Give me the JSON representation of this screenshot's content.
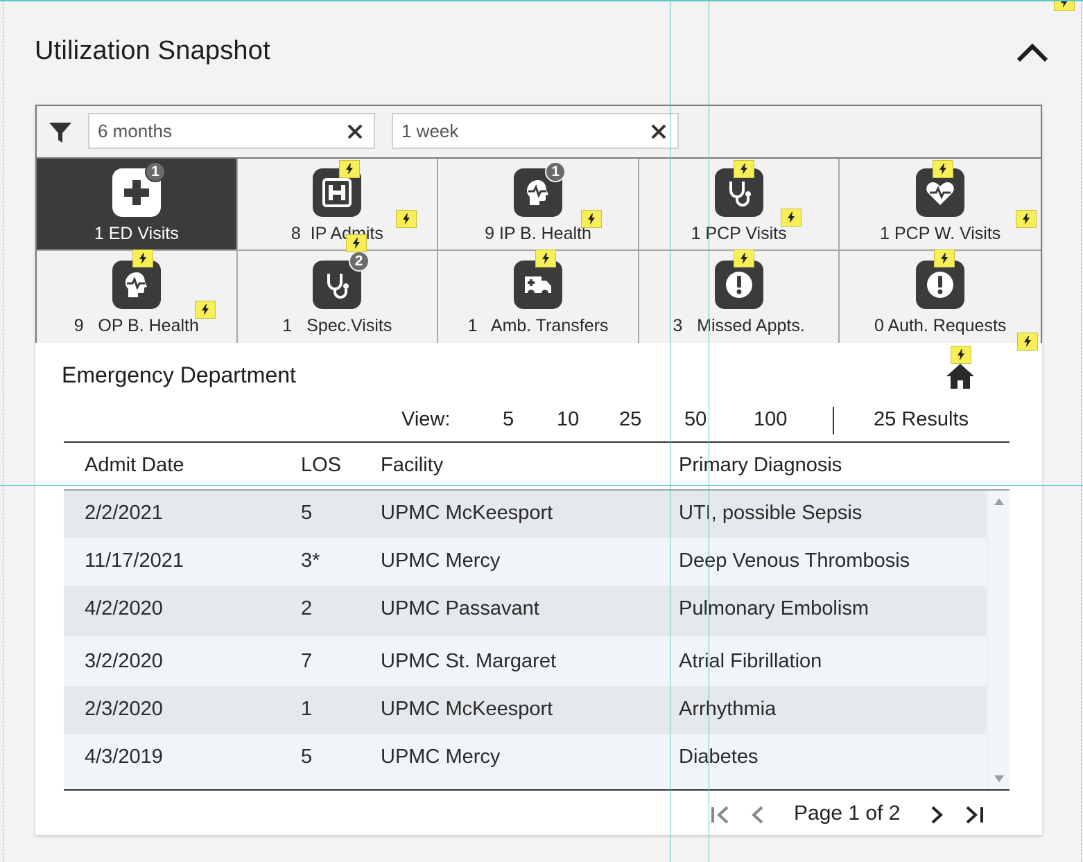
{
  "panel": {
    "title": "Utilization Snapshot"
  },
  "filters": [
    {
      "value": "6 months"
    },
    {
      "value": "1 week"
    }
  ],
  "tiles": [
    {
      "label": "1 ED Visits",
      "icon": "hospital-plus-icon",
      "badge": "1",
      "active": true
    },
    {
      "label": "8  IP Admits",
      "icon": "hospital-h-icon",
      "badge": null,
      "active": false
    },
    {
      "label": "9 IP B. Health",
      "icon": "behavioral-head-icon",
      "badge": "1",
      "active": false
    },
    {
      "label": "1 PCP Visits",
      "icon": "stethoscope-icon",
      "badge": null,
      "active": false
    },
    {
      "label": "1 PCP W. Visits",
      "icon": "heart-pulse-icon",
      "badge": null,
      "active": false
    },
    {
      "label": "9   OP B. Health",
      "icon": "behavioral-head-icon",
      "badge": null,
      "active": false
    },
    {
      "label": "1   Spec.Visits",
      "icon": "stethoscope-icon",
      "badge": "2",
      "active": false
    },
    {
      "label": "1   Amb. Transfers",
      "icon": "ambulance-icon",
      "badge": null,
      "active": false
    },
    {
      "label": "3   Missed Appts.",
      "icon": "alert-icon",
      "badge": null,
      "active": false
    },
    {
      "label": "0 Auth. Requests",
      "icon": "alert-icon",
      "badge": null,
      "active": false
    }
  ],
  "section": {
    "title": "Emergency Department"
  },
  "view": {
    "label": "View:",
    "options": [
      "5",
      "10",
      "25",
      "50",
      "100"
    ],
    "results": "25 Results"
  },
  "table": {
    "columns": [
      "Admit Date",
      "LOS",
      "Facility",
      "Primary Diagnosis"
    ],
    "rows": [
      [
        "2/2/2021",
        "5",
        "UPMC McKeesport",
        "UTI, possible Sepsis"
      ],
      [
        "11/17/2021",
        "3*",
        "UPMC Mercy",
        "Deep Venous Thrombosis"
      ],
      [
        "4/2/2020",
        "2",
        "UPMC Passavant",
        "Pulmonary Embolism"
      ],
      [
        "3/2/2020",
        "7",
        "UPMC St. Margaret",
        "Atrial Fibrillation"
      ],
      [
        "2/3/2020",
        "1",
        "UPMC McKeesport",
        "Arrhythmia"
      ],
      [
        "4/3/2019",
        "5",
        "UPMC Mercy",
        "Diabetes"
      ]
    ]
  },
  "pager": {
    "text": "Page 1 of 2"
  },
  "colors": {
    "tile_dark": "#3b3b3b",
    "hint_yellow": "#f7ee58",
    "guide": "#5cc8c8"
  }
}
